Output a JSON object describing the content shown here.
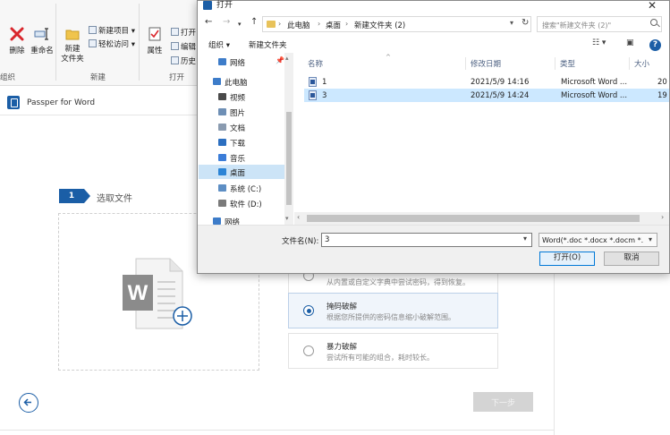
{
  "ribbon": {
    "delete_label": "删除",
    "rename_label": "重命名",
    "new_folder_label": "新建\n文件夹",
    "new_item_label": "新建项目",
    "easy_access_label": "轻松访问",
    "properties_label": "属性",
    "open_label": "打开",
    "edit_label": "编辑",
    "history_label": "历史",
    "group_organize": "组织",
    "group_new": "新建",
    "group_open": "打开"
  },
  "app": {
    "title": "Passper for Word",
    "step_number": "1",
    "step_label": "选取文件",
    "methods": [
      {
        "title": "",
        "desc": "从内置或自定义字典中尝试密码，得到恢复。"
      },
      {
        "title": "掩码破解",
        "desc": "根据您所提供的密码信息缩小破解范围。",
        "selected": true
      },
      {
        "title": "暴力破解",
        "desc": "尝试所有可能的组合，耗时较长。",
        "selected": false
      }
    ],
    "next_label": "下一步"
  },
  "dialog": {
    "title": "打开",
    "close_glyph": "✕",
    "path": [
      "此电脑",
      "桌面",
      "新建文件夹 (2)"
    ],
    "search_placeholder": "搜索\"新建文件夹 (2)\"",
    "organize_label": "组织 ▾",
    "new_folder_label": "新建文件夹",
    "help_label": "?",
    "nav_items": [
      {
        "label": "网络",
        "icon": "network-icon",
        "color": "#3d7cc9",
        "pinned": true
      },
      {
        "label": "此电脑",
        "icon": "computer-icon",
        "color": "#3d7cc9"
      },
      {
        "label": "视频",
        "icon": "video-folder-icon",
        "color": "#4a4a4a"
      },
      {
        "label": "图片",
        "icon": "pictures-folder-icon",
        "color": "#6e8fb5"
      },
      {
        "label": "文档",
        "icon": "documents-folder-icon",
        "color": "#8a9bb0"
      },
      {
        "label": "下载",
        "icon": "downloads-folder-icon",
        "color": "#2c6fc0"
      },
      {
        "label": "音乐",
        "icon": "music-folder-icon",
        "color": "#3b7dd8"
      },
      {
        "label": "桌面",
        "icon": "desktop-folder-icon",
        "color": "#2b84d6",
        "selected": true
      },
      {
        "label": "系统 (C:)",
        "icon": "drive-c-icon",
        "color": "#5d8ec4"
      },
      {
        "label": "软件 (D:)",
        "icon": "drive-d-icon",
        "color": "#7a7a7a"
      },
      {
        "label": "网络",
        "icon": "network-icon",
        "color": "#3d7cc9"
      }
    ],
    "columns": [
      "名称",
      "修改日期",
      "类型",
      "大小"
    ],
    "files": [
      {
        "name": "1",
        "date": "2021/5/9 14:16",
        "type": "Microsoft Word ...",
        "size": "20",
        "selected": false
      },
      {
        "name": "3",
        "date": "2021/5/9 14:24",
        "type": "Microsoft Word ...",
        "size": "19",
        "selected": true
      }
    ],
    "filename_label": "文件名(N):",
    "filename_value": "3",
    "filetype_value": "Word(*.doc *.docx *.docm *.",
    "open_button": "打开(O)",
    "cancel_button": "取消"
  }
}
